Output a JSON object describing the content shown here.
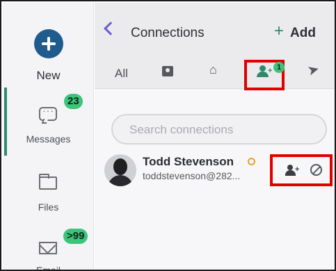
{
  "sidebar": {
    "new_label": "New",
    "messages": {
      "label": "Messages",
      "badge": "23"
    },
    "files": {
      "label": "Files"
    },
    "email": {
      "label": "Email",
      "badge": ">99"
    }
  },
  "header": {
    "title": "Connections",
    "add_icon": "+",
    "add_label": "Add"
  },
  "tabs": {
    "all_label": "All",
    "requests_badge": "1",
    "icons": [
      "contact-card-icon",
      "building-icon",
      "add-person-icon",
      "send-icon"
    ]
  },
  "search": {
    "placeholder": "Search connections"
  },
  "connections": [
    {
      "name": "Todd Stevenson",
      "email": "toddstevenson@282..."
    }
  ],
  "colors": {
    "accent": "#2e8a6a",
    "badge": "#3cc47a",
    "brand": "#1f5b8c",
    "highlight": "#e00000",
    "back": "#6a5bd6"
  }
}
